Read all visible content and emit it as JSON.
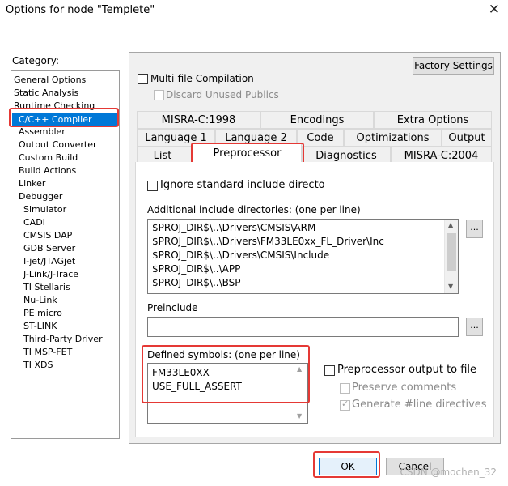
{
  "window": {
    "title": "Options for node \"Templete\"",
    "close_glyph": "✕"
  },
  "category": {
    "label": "Category:",
    "items": [
      "General Options",
      "Static Analysis",
      "Runtime Checking",
      "C/C++ Compiler",
      "Assembler",
      "Output Converter",
      "Custom Build",
      "Build Actions",
      "Linker",
      "Debugger",
      "Simulator",
      "CADI",
      "CMSIS DAP",
      "GDB Server",
      "I-jet/JTAGjet",
      "J-Link/J-Trace",
      "TI Stellaris",
      "Nu-Link",
      "PE micro",
      "ST-LINK",
      "Third-Party Driver",
      "TI MSP-FET",
      "TI XDS"
    ]
  },
  "factory_settings": "Factory Settings",
  "multi_file": "Multi-file Compilation",
  "discard_unused": "Discard Unused Publics",
  "tabs": {
    "row1": [
      "MISRA-C:1998",
      "Encodings",
      "Extra Options"
    ],
    "row2": [
      "Language 1",
      "Language 2",
      "Code",
      "Optimizations",
      "Output"
    ],
    "row3": [
      "List",
      "Preprocessor",
      "Diagnostics",
      "MISRA-C:2004"
    ]
  },
  "preprocessor": {
    "ignore_std": "Ignore standard include directories",
    "include_label": "Additional include directories: (one per line)",
    "include_dirs": [
      "$PROJ_DIR$\\..\\Drivers\\CMSIS\\ARM",
      "$PROJ_DIR$\\..\\Drivers\\FM33LE0xx_FL_Driver\\Inc",
      "$PROJ_DIR$\\..\\Drivers\\CMSIS\\Include",
      "$PROJ_DIR$\\..\\APP",
      "$PROJ_DIR$\\..\\BSP"
    ],
    "browse": "...",
    "preinclude_label": "Preinclude",
    "preinclude_value": "",
    "defined_label": "Defined symbols: (one per line)",
    "defined_symbols": [
      "FM33LE0XX",
      "USE_FULL_ASSERT"
    ],
    "pp_output": "Preprocessor output to file",
    "preserve_comments": "Preserve comments",
    "generate_line": "Generate #line directives"
  },
  "ok": "OK",
  "cancel": "Cancel",
  "watermark": "CSDN @mochen_32",
  "colors": {
    "highlight": "#0078d7",
    "annotation": "#e53935"
  }
}
